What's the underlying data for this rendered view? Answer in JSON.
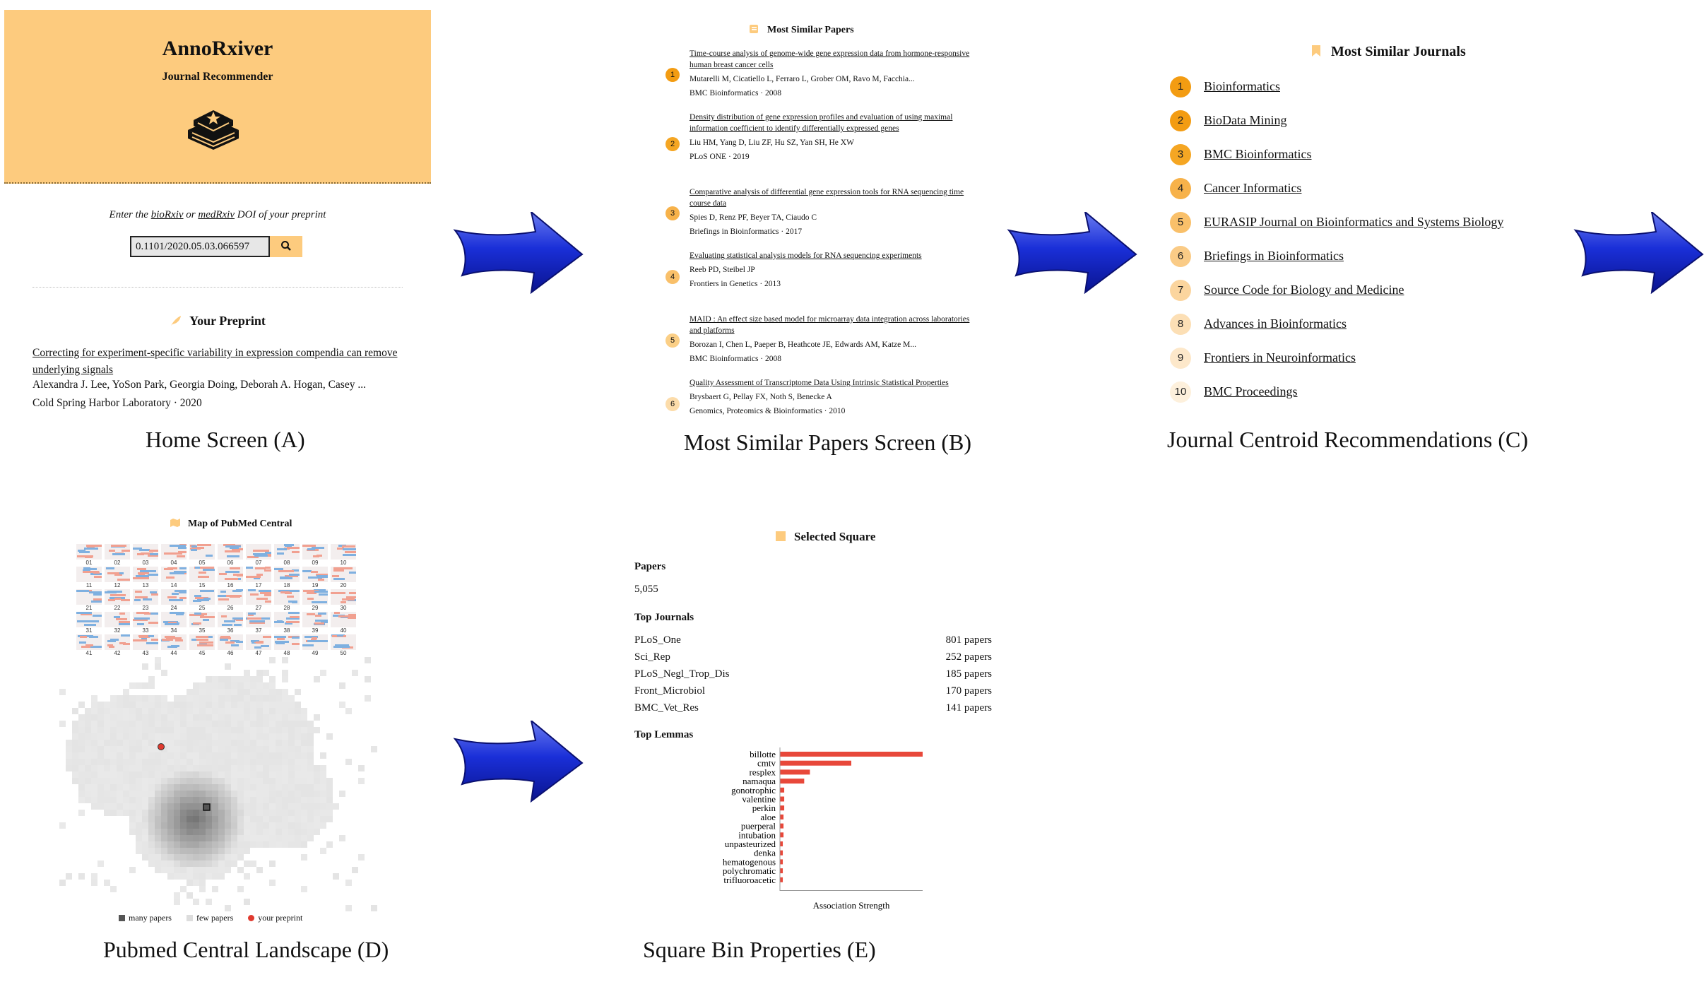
{
  "panel_a": {
    "title": "AnnoRxiver",
    "subtitle": "Journal Recommender",
    "logo_icon": "books-star-icon",
    "prompt_pre": "Enter the ",
    "prompt_link1": "bioRxiv",
    "prompt_mid": " or ",
    "prompt_link2": "medRxiv",
    "prompt_post": " DOI of your preprint",
    "doi_value": "0.1101/2020.05.03.066597",
    "search_icon": "search-icon",
    "section_title": "Your Preprint",
    "section_icon": "feather-icon",
    "paper_title": "Correcting for experiment-specific variability in expression compendia can remove underlying signals",
    "paper_authors": "Alexandra J. Lee, YoSon Park, Georgia Doing, Deborah A. Hogan, Casey ...",
    "paper_venue": "Cold Spring Harbor Laboratory · 2020",
    "caption": "Home Screen (A)",
    "accent_color": "#fdcb7e"
  },
  "panel_b": {
    "section_title": "Most Similar Papers",
    "section_icon": "scroll-icon",
    "caption": "Most Similar Papers Screen (B)",
    "papers": [
      {
        "rank": "1",
        "title": "Time-course analysis of genome-wide gene expression data from hormone-responsive human breast cancer cells",
        "authors": "Mutarelli M, Cicatiello L, Ferraro L, Grober OM, Ravo M, Facchia...",
        "venue": "BMC Bioinformatics · 2008"
      },
      {
        "rank": "2",
        "title": "Density distribution of gene expression profiles and evaluation of using maximal information coefficient to identify differentially expressed genes",
        "authors": "Liu HM, Yang D, Liu ZF, Hu SZ, Yan SH, He XW",
        "venue": "PLoS ONE · 2019"
      },
      {
        "rank": "3",
        "title": "Comparative analysis of differential gene expression tools for RNA sequencing time course data",
        "authors": "Spies D, Renz PF, Beyer TA, Ciaudo C",
        "venue": "Briefings in Bioinformatics · 2017"
      },
      {
        "rank": "4",
        "title": "Evaluating statistical analysis models for RNA sequencing experiments",
        "authors": "Reeb PD, Steibel JP",
        "venue": "Frontiers in Genetics · 2013"
      },
      {
        "rank": "5",
        "title": "MAID : An effect size based model for microarray data integration across laboratories and platforms",
        "authors": "Borozan I, Chen L, Paeper B, Heathcote JE, Edwards AM, Katze M...",
        "venue": "BMC Bioinformatics · 2008"
      },
      {
        "rank": "6",
        "title": "Quality Assessment of Transcriptome Data Using Intrinsic Statistical Properties",
        "authors": "Brysbaert G, Pellay FX, Noth S, Benecke A",
        "venue": "Genomics, Proteomics & Bioinformatics · 2010"
      }
    ]
  },
  "panel_c": {
    "section_title": "Most Similar Journals",
    "section_icon": "bookmark-icon",
    "caption": "Journal Centroid Recommendations (C)",
    "journals": [
      {
        "rank": "1",
        "name": "Bioinformatics",
        "color": "#f39c12"
      },
      {
        "rank": "2",
        "name": "BioData Mining",
        "color": "#f39c12"
      },
      {
        "rank": "3",
        "name": "BMC Bioinformatics",
        "color": "#f5a623"
      },
      {
        "rank": "4",
        "name": "Cancer Informatics",
        "color": "#f7b24a"
      },
      {
        "rank": "5",
        "name": "EURASIP Journal on Bioinformatics and Systems Biology",
        "color": "#f9c06a"
      },
      {
        "rank": "6",
        "name": "Briefings in Bioinformatics",
        "color": "#facb86"
      },
      {
        "rank": "7",
        "name": "Source Code for Biology and Medicine",
        "color": "#fbd59e"
      },
      {
        "rank": "8",
        "name": "Advances in Bioinformatics",
        "color": "#fcdfb5"
      },
      {
        "rank": "9",
        "name": "Frontiers in Neuroinformatics",
        "color": "#fde8ca"
      },
      {
        "rank": "10",
        "name": "BMC Proceedings",
        "color": "#fdf0dc"
      }
    ]
  },
  "panel_d": {
    "section_title": "Map of PubMed Central",
    "section_icon": "map-icon",
    "caption": "Pubmed Central Landscape (D)",
    "tile_numbers": [
      "01",
      "02",
      "03",
      "04",
      "05",
      "06",
      "07",
      "08",
      "09",
      "10",
      "11",
      "12",
      "13",
      "14",
      "15",
      "16",
      "17",
      "18",
      "19",
      "20",
      "21",
      "22",
      "23",
      "24",
      "25",
      "26",
      "27",
      "28",
      "29",
      "30",
      "31",
      "32",
      "33",
      "34",
      "35",
      "36",
      "37",
      "38",
      "39",
      "40",
      "41",
      "42",
      "43",
      "44",
      "45",
      "46",
      "47",
      "48",
      "49",
      "50"
    ],
    "legend": {
      "many": "many papers",
      "few": "few papers",
      "yours": "your preprint"
    },
    "colors": {
      "many": "#555555",
      "few": "#dddddd",
      "yours": "#e03a2f"
    }
  },
  "panel_e": {
    "section_title": "Selected Square",
    "section_icon": "square-icon",
    "caption": "Square Bin Properties (E)",
    "papers_label": "Papers",
    "papers_count": "5,055",
    "journals_label": "Top Journals",
    "journals": [
      {
        "name": "PLoS_One",
        "count": "801 papers"
      },
      {
        "name": "Sci_Rep",
        "count": "252 papers"
      },
      {
        "name": "PLoS_Negl_Trop_Dis",
        "count": "185 papers"
      },
      {
        "name": "Front_Microbiol",
        "count": "170 papers"
      },
      {
        "name": "BMC_Vet_Res",
        "count": "141 papers"
      }
    ],
    "lemmas_label": "Top Lemmas",
    "chart_data": {
      "type": "bar",
      "orientation": "horizontal",
      "categories": [
        "billotte",
        "cmtv",
        "resplex",
        "namaqua",
        "gonotrophic",
        "valentine",
        "perkin",
        "aloe",
        "puerperal",
        "intubation",
        "unpasteurized",
        "denka",
        "hematogenous",
        "polychromatic",
        "trifluoroacetic"
      ],
      "values": [
        1.0,
        0.5,
        0.21,
        0.17,
        0.03,
        0.03,
        0.03,
        0.025,
        0.025,
        0.025,
        0.02,
        0.02,
        0.02,
        0.02,
        0.02
      ],
      "xlabel": "Association Strength",
      "bar_color": "#e8483a"
    }
  }
}
